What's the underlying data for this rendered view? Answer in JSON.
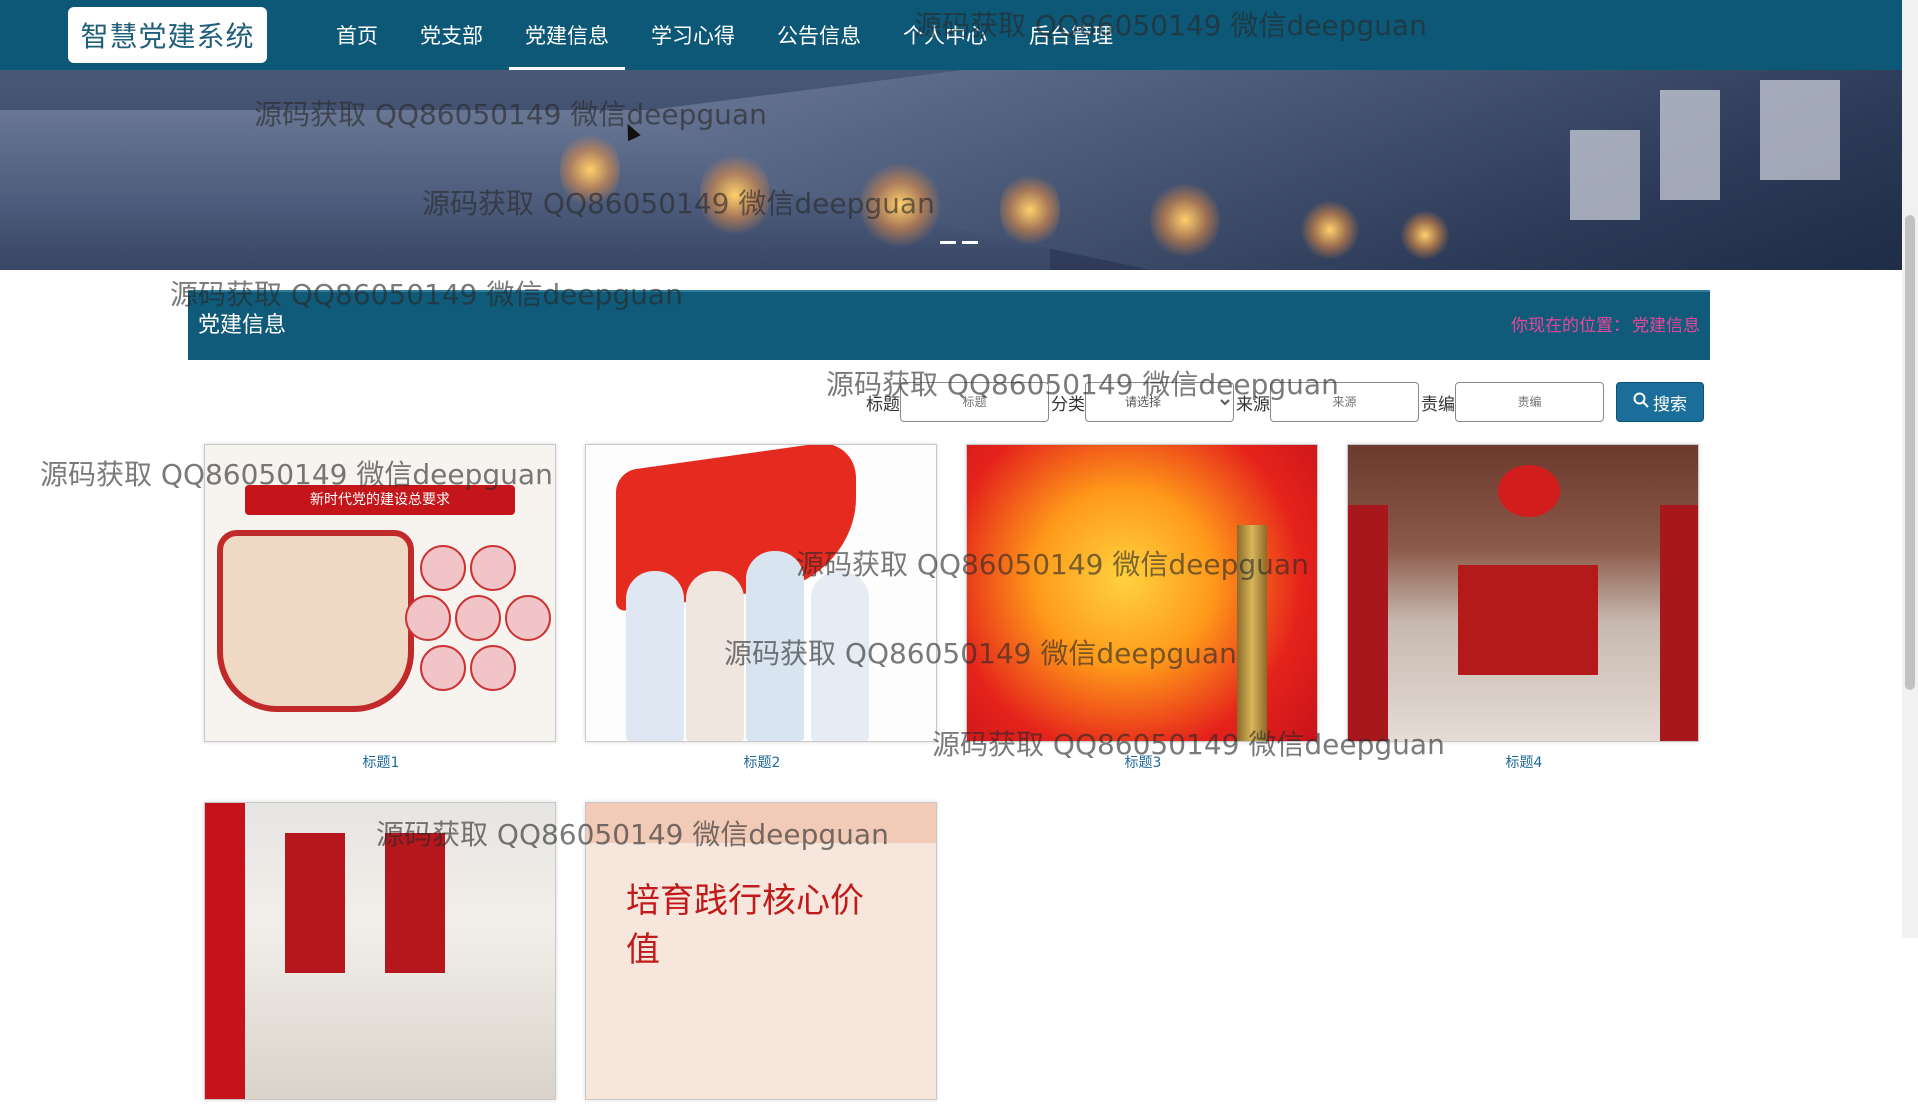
{
  "app": {
    "logo_text": "智慧党建系统"
  },
  "nav": {
    "items": [
      {
        "label": "首页",
        "active": false
      },
      {
        "label": "党支部",
        "active": false
      },
      {
        "label": "党建信息",
        "active": true
      },
      {
        "label": "学习心得",
        "active": false
      },
      {
        "label": "公告信息",
        "active": false
      },
      {
        "label": "个人中心",
        "active": false
      },
      {
        "label": "后台管理",
        "active": false
      }
    ]
  },
  "section": {
    "title": "党建信息",
    "location_prefix": "你现在的位置：",
    "location_current": "党建信息"
  },
  "search": {
    "title_label": "标题",
    "title_placeholder": "标题",
    "category_label": "分类",
    "category_selected": "请选择",
    "source_label": "来源",
    "source_placeholder": "来源",
    "editor_label": "责编",
    "editor_placeholder": "责编",
    "button_label": "搜索"
  },
  "cards": [
    {
      "title": "标题1"
    },
    {
      "title": "标题2"
    },
    {
      "title": "标题3"
    },
    {
      "title": "标题4"
    },
    {
      "title": ""
    },
    {
      "title": ""
    }
  ],
  "thumb_text": {
    "t1_banner": "新时代党的建设总要求",
    "t6_brush": "培育践行核心价值"
  },
  "watermark": "源码获取 QQ86050149 微信deepguan",
  "colors": {
    "nav_bg": "#0d5877",
    "section_bg": "#105b79",
    "location_text": "#e8469a",
    "search_button": "#1b6e9a",
    "card_title": "#1f6a9a"
  }
}
